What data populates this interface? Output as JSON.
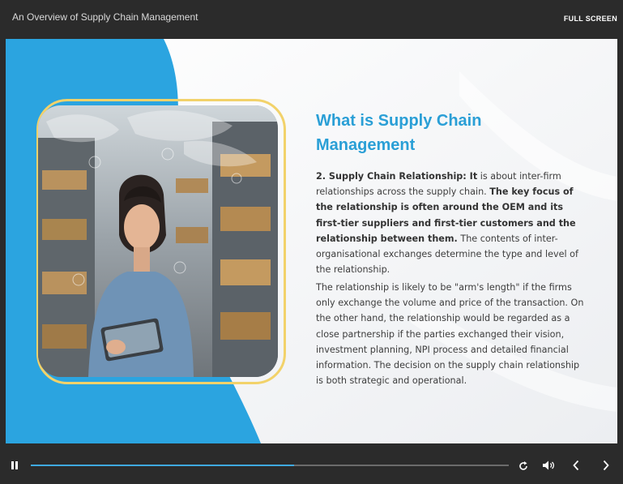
{
  "topbar": {
    "course_title": "An Overview of Supply Chain Management",
    "fullscreen_label": "FULL SCREEN"
  },
  "slide": {
    "heading_line1": "What is Supply Chain",
    "heading_line2": "Management",
    "p1": {
      "lead": "2. Supply Chain Relationship: It",
      "text1": " is about inter-firm relationships across the supply chain. ",
      "bold": "The key focus of the relationship is often around the OEM and its first-tier suppliers and first-tier customers and the relationship between them.",
      "text2": " The contents of inter-organisational exchanges determine the type and level of the relationship."
    },
    "p2": "The relationship is likely to be \"arm's length\" if the firms only exchange the volume and price of the transaction. On the other hand, the relationship would be regarded as a close partnership if the parties exchanged their vision, investment planning, NPI process and detailed financial information. The decision on the supply chain relationship is both strategic and operational.",
    "colors": {
      "accent_blue": "#2ba4e0",
      "frame_yellow": "#f2d26a",
      "heading": "#2a9fd6"
    },
    "image": "woman-with-tablet-in-warehouse"
  },
  "player": {
    "progress_fraction": 0.55,
    "icons": [
      "pause-icon",
      "replay-icon",
      "volume-icon",
      "prev-icon",
      "next-icon"
    ]
  }
}
